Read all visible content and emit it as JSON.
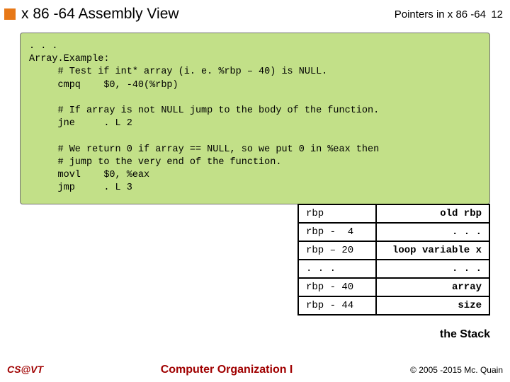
{
  "header": {
    "title": "x 86 -64 Assembly View",
    "topic": "Pointers in x 86 -64",
    "page": "12"
  },
  "code": ". . .\nArray.Example:\n     # Test if int* array (i. e. %rbp – 40) is NULL.\n     cmpq    $0, -40(%rbp)\n\n     # If array is not NULL jump to the body of the function.\n     jne     . L 2\n\n     # We return 0 if array == NULL, so we put 0 in %eax then\n     # jump to the very end of the function.\n     movl    $0, %eax\n     jmp     . L 3",
  "stack": {
    "label": "the Stack",
    "rows": [
      {
        "offset": "rbp",
        "value": "old rbp"
      },
      {
        "offset": "rbp -  4",
        "value": ". . ."
      },
      {
        "offset": "rbp – 20",
        "value": "loop variable x"
      },
      {
        "offset": ". . .",
        "value": ". . ."
      },
      {
        "offset": "rbp - 40",
        "value": "array"
      },
      {
        "offset": "rbp - 44",
        "value": "size"
      }
    ]
  },
  "footer": {
    "left": "CS@VT",
    "center": "Computer Organization I",
    "right": "© 2005 -2015 Mc. Quain"
  }
}
